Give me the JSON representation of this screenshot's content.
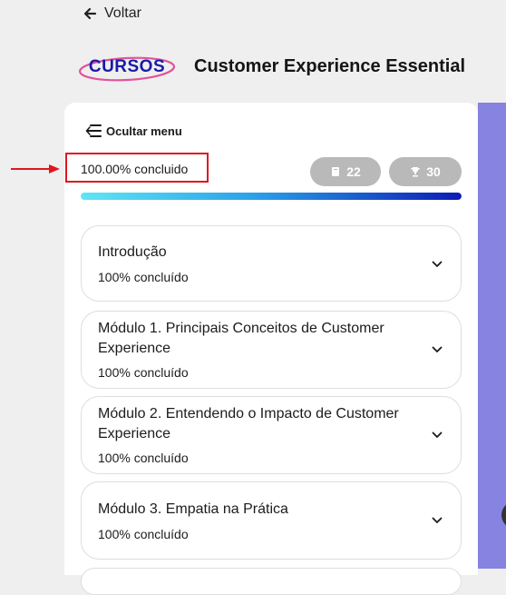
{
  "nav": {
    "back_label": "Voltar"
  },
  "brand": {
    "logo_text": "CURSOS",
    "logo_color": "#1a1aa8",
    "ellipse_color": "#e0539a"
  },
  "course": {
    "title": "Customer Experience Essential"
  },
  "menu": {
    "hide_label": "Ocultar menu"
  },
  "progress": {
    "label": "100.00% concluido",
    "percent": 100
  },
  "badges": {
    "lessons": "22",
    "trophies": "30"
  },
  "modules": [
    {
      "title": "Introdução",
      "status": "100% concluído"
    },
    {
      "title": "Módulo 1. Principais Conceitos de Customer Experience",
      "status": "100% concluído"
    },
    {
      "title": "Módulo 2. Entendendo o Impacto de Customer Experience",
      "status": "100% concluído"
    },
    {
      "title": "Módulo 3. Empatia na Prática",
      "status": "100% concluído"
    }
  ],
  "colors": {
    "accent_purple": "#8683e1",
    "annotation_red": "#e0161d",
    "badge_gray": "#b9b9b9"
  },
  "icons": {
    "back": "arrow-left-icon",
    "menu": "menu-collapse-icon",
    "lessons": "book-icon",
    "trophies": "trophy-icon",
    "expand": "chevron-down-icon"
  }
}
